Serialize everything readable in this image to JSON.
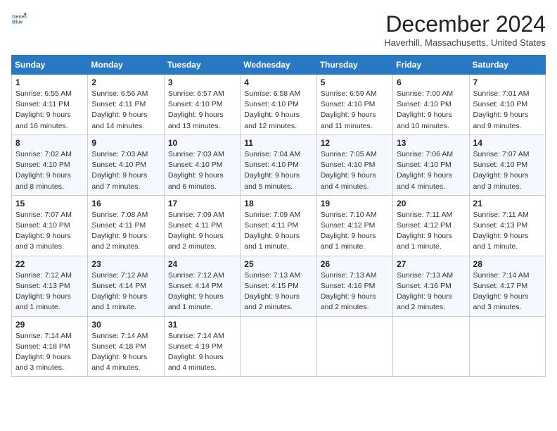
{
  "header": {
    "logo_general": "General",
    "logo_blue": "Blue",
    "month": "December 2024",
    "location": "Haverhill, Massachusetts, United States"
  },
  "weekdays": [
    "Sunday",
    "Monday",
    "Tuesday",
    "Wednesday",
    "Thursday",
    "Friday",
    "Saturday"
  ],
  "weeks": [
    [
      {
        "day": "1",
        "sunrise": "6:55 AM",
        "sunset": "4:11 PM",
        "daylight": "9 hours and 16 minutes."
      },
      {
        "day": "2",
        "sunrise": "6:56 AM",
        "sunset": "4:11 PM",
        "daylight": "9 hours and 14 minutes."
      },
      {
        "day": "3",
        "sunrise": "6:57 AM",
        "sunset": "4:10 PM",
        "daylight": "9 hours and 13 minutes."
      },
      {
        "day": "4",
        "sunrise": "6:58 AM",
        "sunset": "4:10 PM",
        "daylight": "9 hours and 12 minutes."
      },
      {
        "day": "5",
        "sunrise": "6:59 AM",
        "sunset": "4:10 PM",
        "daylight": "9 hours and 11 minutes."
      },
      {
        "day": "6",
        "sunrise": "7:00 AM",
        "sunset": "4:10 PM",
        "daylight": "9 hours and 10 minutes."
      },
      {
        "day": "7",
        "sunrise": "7:01 AM",
        "sunset": "4:10 PM",
        "daylight": "9 hours and 9 minutes."
      }
    ],
    [
      {
        "day": "8",
        "sunrise": "7:02 AM",
        "sunset": "4:10 PM",
        "daylight": "9 hours and 8 minutes."
      },
      {
        "day": "9",
        "sunrise": "7:03 AM",
        "sunset": "4:10 PM",
        "daylight": "9 hours and 7 minutes."
      },
      {
        "day": "10",
        "sunrise": "7:03 AM",
        "sunset": "4:10 PM",
        "daylight": "9 hours and 6 minutes."
      },
      {
        "day": "11",
        "sunrise": "7:04 AM",
        "sunset": "4:10 PM",
        "daylight": "9 hours and 5 minutes."
      },
      {
        "day": "12",
        "sunrise": "7:05 AM",
        "sunset": "4:10 PM",
        "daylight": "9 hours and 4 minutes."
      },
      {
        "day": "13",
        "sunrise": "7:06 AM",
        "sunset": "4:10 PM",
        "daylight": "9 hours and 4 minutes."
      },
      {
        "day": "14",
        "sunrise": "7:07 AM",
        "sunset": "4:10 PM",
        "daylight": "9 hours and 3 minutes."
      }
    ],
    [
      {
        "day": "15",
        "sunrise": "7:07 AM",
        "sunset": "4:10 PM",
        "daylight": "9 hours and 3 minutes."
      },
      {
        "day": "16",
        "sunrise": "7:08 AM",
        "sunset": "4:11 PM",
        "daylight": "9 hours and 2 minutes."
      },
      {
        "day": "17",
        "sunrise": "7:09 AM",
        "sunset": "4:11 PM",
        "daylight": "9 hours and 2 minutes."
      },
      {
        "day": "18",
        "sunrise": "7:09 AM",
        "sunset": "4:11 PM",
        "daylight": "9 hours and 1 minute."
      },
      {
        "day": "19",
        "sunrise": "7:10 AM",
        "sunset": "4:12 PM",
        "daylight": "9 hours and 1 minute."
      },
      {
        "day": "20",
        "sunrise": "7:11 AM",
        "sunset": "4:12 PM",
        "daylight": "9 hours and 1 minute."
      },
      {
        "day": "21",
        "sunrise": "7:11 AM",
        "sunset": "4:13 PM",
        "daylight": "9 hours and 1 minute."
      }
    ],
    [
      {
        "day": "22",
        "sunrise": "7:12 AM",
        "sunset": "4:13 PM",
        "daylight": "9 hours and 1 minute."
      },
      {
        "day": "23",
        "sunrise": "7:12 AM",
        "sunset": "4:14 PM",
        "daylight": "9 hours and 1 minute."
      },
      {
        "day": "24",
        "sunrise": "7:12 AM",
        "sunset": "4:14 PM",
        "daylight": "9 hours and 1 minute."
      },
      {
        "day": "25",
        "sunrise": "7:13 AM",
        "sunset": "4:15 PM",
        "daylight": "9 hours and 2 minutes."
      },
      {
        "day": "26",
        "sunrise": "7:13 AM",
        "sunset": "4:16 PM",
        "daylight": "9 hours and 2 minutes."
      },
      {
        "day": "27",
        "sunrise": "7:13 AM",
        "sunset": "4:16 PM",
        "daylight": "9 hours and 2 minutes."
      },
      {
        "day": "28",
        "sunrise": "7:14 AM",
        "sunset": "4:17 PM",
        "daylight": "9 hours and 3 minutes."
      }
    ],
    [
      {
        "day": "29",
        "sunrise": "7:14 AM",
        "sunset": "4:18 PM",
        "daylight": "9 hours and 3 minutes."
      },
      {
        "day": "30",
        "sunrise": "7:14 AM",
        "sunset": "4:18 PM",
        "daylight": "9 hours and 4 minutes."
      },
      {
        "day": "31",
        "sunrise": "7:14 AM",
        "sunset": "4:19 PM",
        "daylight": "9 hours and 4 minutes."
      },
      null,
      null,
      null,
      null
    ]
  ]
}
